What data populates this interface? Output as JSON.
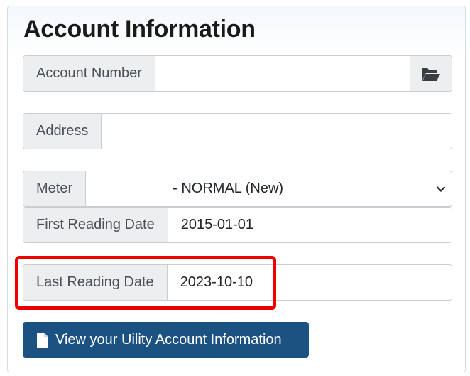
{
  "title": "Account Information",
  "account": {
    "label": "Account Number",
    "value": ""
  },
  "address": {
    "label": "Address",
    "value": ""
  },
  "meter": {
    "label": "Meter",
    "selected": "- NORMAL (New)"
  },
  "first_reading": {
    "label": "First Reading Date",
    "value": "2015-01-01"
  },
  "last_reading": {
    "label": "Last Reading Date",
    "value": "2023-10-10"
  },
  "view_button": {
    "label": "View your Uility Account Information"
  },
  "colors": {
    "primary": "#1c5282",
    "highlight": "#ee0000",
    "addon_bg": "#eceeef"
  },
  "icons": {
    "browse": "folder-open-icon",
    "document": "file-icon",
    "dropdown": "chevron-down-icon"
  }
}
